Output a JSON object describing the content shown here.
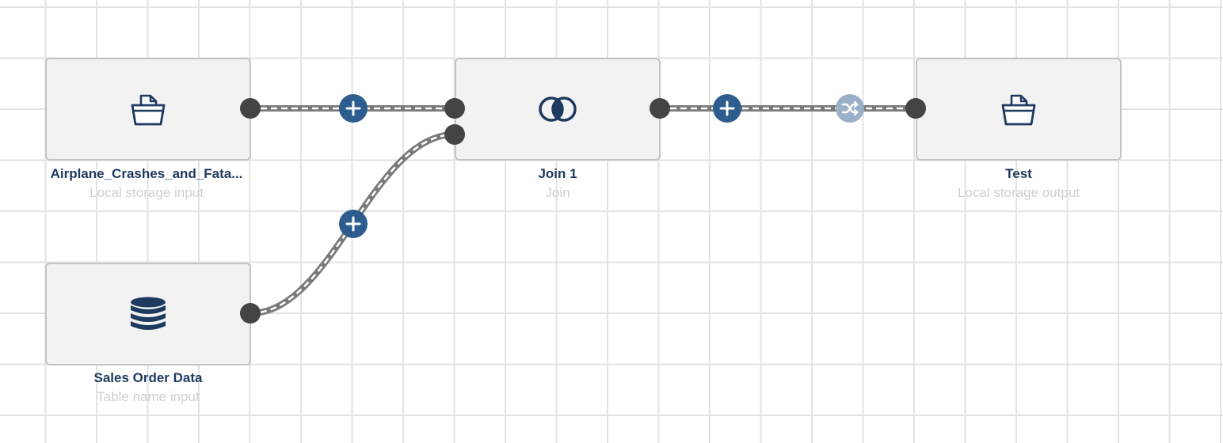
{
  "colors": {
    "node_icon": "#1e3a5f",
    "node_name": "#1e3a5f",
    "node_type": "#cfcfcf",
    "node_border": "#c4c4c4",
    "node_fill": "#f2f2f2",
    "port": "#444444",
    "add_button": "#2d5c8e",
    "shuffle_button": "#9aafc8",
    "edge": "#7a7a7a",
    "grid": "#e3e3e3"
  },
  "nodes": {
    "airplane": {
      "name": "Airplane_Crashes_and_Fata...",
      "type": "Local storage input",
      "icon": "storage-tray-icon"
    },
    "sales": {
      "name": "Sales Order Data",
      "type": "Table name input",
      "icon": "database-icon"
    },
    "join": {
      "name": "Join 1",
      "type": "Join",
      "icon": "join-circles-icon"
    },
    "test": {
      "name": "Test",
      "type": "Local storage output",
      "icon": "storage-tray-icon"
    }
  },
  "edge_controls": {
    "add_icon": "plus-icon",
    "shuffle_icon": "shuffle-icon"
  }
}
